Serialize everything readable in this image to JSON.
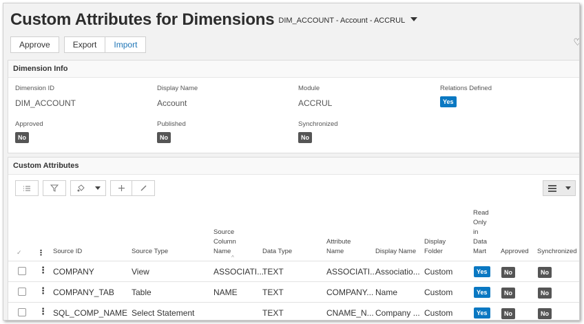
{
  "header": {
    "title": "Custom Attributes for Dimensions",
    "subtitle": "DIM_ACCOUNT - Account - ACCRUL",
    "buttons": {
      "approve": "Approve",
      "export": "Export",
      "import": "Import"
    }
  },
  "dimension_info": {
    "title": "Dimension Info",
    "fields": {
      "dimension_id": {
        "label": "Dimension ID",
        "value": "DIM_ACCOUNT"
      },
      "display_name": {
        "label": "Display Name",
        "value": "Account"
      },
      "module": {
        "label": "Module",
        "value": "ACCRUL"
      },
      "relations_defined": {
        "label": "Relations Defined",
        "value": "Yes"
      },
      "approved": {
        "label": "Approved",
        "value": "No"
      },
      "published": {
        "label": "Published",
        "value": "No"
      },
      "synchronized": {
        "label": "Synchronized",
        "value": "No"
      }
    }
  },
  "custom_attributes": {
    "title": "Custom Attributes",
    "columns": {
      "source_id": "Source ID",
      "source_type": "Source Type",
      "source_column_name": [
        "Source",
        "Column",
        "Name"
      ],
      "data_type": "Data Type",
      "attribute_name": [
        "Attribute",
        "Name"
      ],
      "display_name": "Display Name",
      "display_folder": [
        "Display",
        "Folder"
      ],
      "read_only": [
        "Read",
        "Only",
        "in",
        "Data",
        "Mart"
      ],
      "approved": "Approved",
      "synchronized": "Synchronized"
    },
    "rows": [
      {
        "source_id": "COMPANY",
        "source_type": "View",
        "source_column_name": "ASSOCIATI...",
        "data_type": "TEXT",
        "attribute_name": "ASSOCIATI...",
        "display_name": "Associatio...",
        "display_folder": "Custom",
        "read_only": "Yes",
        "approved": "No",
        "synchronized": "No"
      },
      {
        "source_id": "COMPANY_TAB",
        "source_type": "Table",
        "source_column_name": "NAME",
        "data_type": "TEXT",
        "attribute_name": "COMPANY...",
        "display_name": "Name",
        "display_folder": "Custom",
        "read_only": "Yes",
        "approved": "No",
        "synchronized": "No"
      },
      {
        "source_id": "SQL_COMP_NAME",
        "source_type": "Select Statement",
        "source_column_name": "",
        "data_type": "TEXT",
        "attribute_name": "CNAME_N...",
        "display_name": "Company ...",
        "display_folder": "Custom",
        "read_only": "Yes",
        "approved": "No",
        "synchronized": "No"
      }
    ]
  },
  "icons": {
    "subtitle_caret": "caret-down-icon",
    "favorite": "heart-icon",
    "toolbar": [
      "column-list-icon",
      "filter-icon",
      "paint-bucket-icon",
      "dropdown-caret-icon",
      "plus-icon",
      "pencil-icon",
      "table-view-icon",
      "dropdown-caret-icon"
    ]
  },
  "colors": {
    "yes_badge": "#0a78c2",
    "no_badge": "#555555",
    "import_link": "#1b73b5"
  }
}
